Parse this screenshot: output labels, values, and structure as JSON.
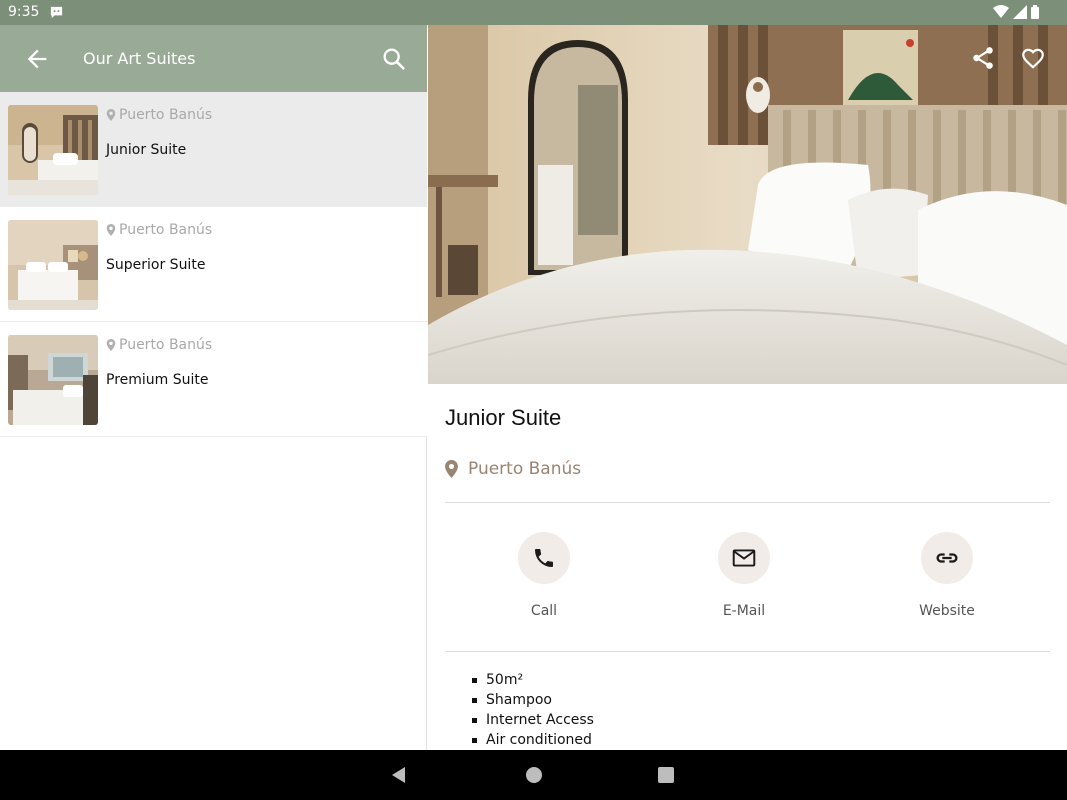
{
  "status_bar": {
    "time": "9:35"
  },
  "app_bar": {
    "title": "Our Art Suites"
  },
  "suites": [
    {
      "location": "Puerto Banús",
      "name": "Junior Suite",
      "selected": true
    },
    {
      "location": "Puerto Banús",
      "name": "Superior Suite",
      "selected": false
    },
    {
      "location": "Puerto Banús",
      "name": "Premium Suite",
      "selected": false
    }
  ],
  "detail": {
    "title": "Junior Suite",
    "location": "Puerto Banús",
    "actions": {
      "call": "Call",
      "email": "E-Mail",
      "website": "Website"
    },
    "amenities": [
      "50m²",
      "Shampoo",
      "Internet Access",
      "Air conditioned"
    ]
  },
  "colors": {
    "status_bar": "#7c8f79",
    "app_bar": "#99aa96",
    "location_accent": "#9a8472",
    "action_circle": "#f2ece8"
  },
  "icons": [
    "back-arrow-icon",
    "search-icon",
    "location-pin-icon",
    "share-icon",
    "heart-icon",
    "phone-icon",
    "mail-icon",
    "link-icon"
  ]
}
